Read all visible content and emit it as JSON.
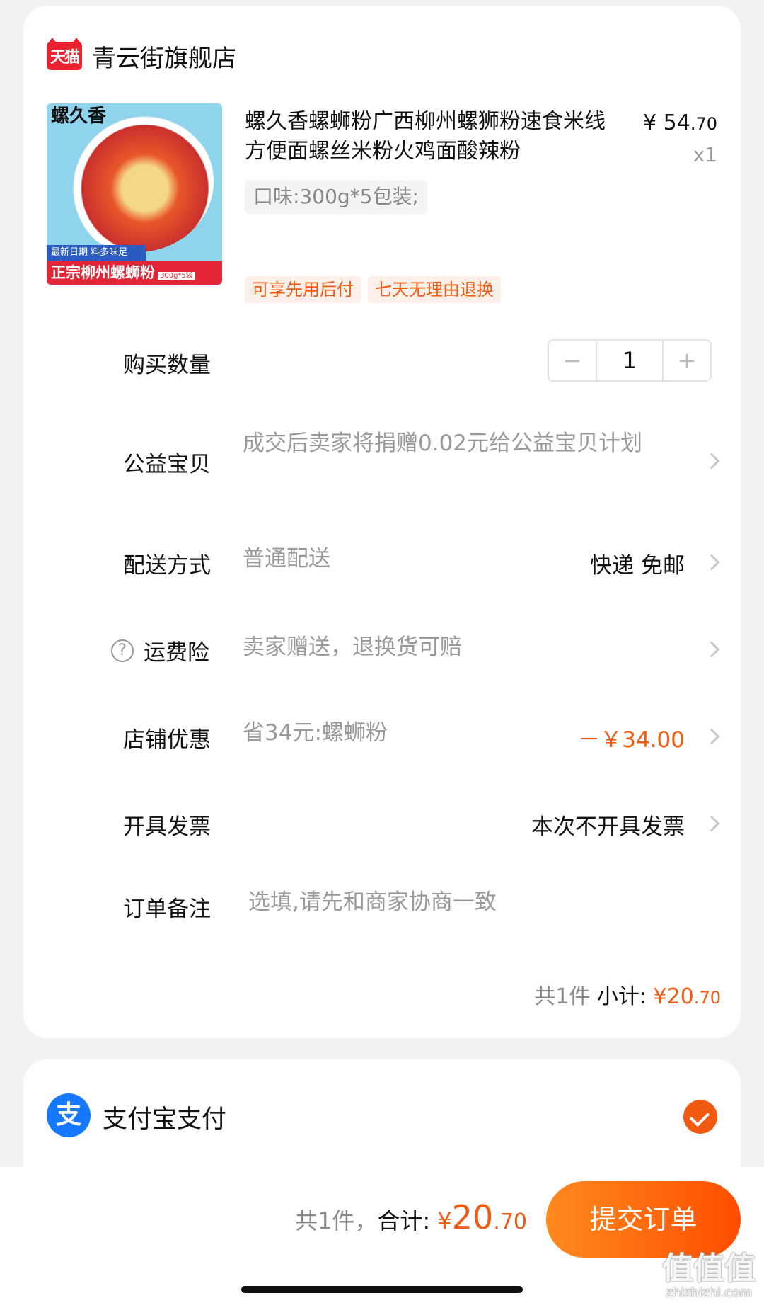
{
  "shop": {
    "logo_text": "天猫",
    "name": "青云街旗舰店"
  },
  "product": {
    "image": {
      "brand_text": "螺久香",
      "band1_text": "最新日期 料多味足",
      "band2_text": "正宗柳州螺蛳粉",
      "band2_small": "300g*5袋"
    },
    "title": "螺久香螺蛳粉广西柳州螺狮粉速食米线方便面螺丝米粉火鸡面酸辣粉",
    "price_yen": "¥",
    "price_int": "54",
    "price_dec": ".70",
    "quantity": "x1",
    "sku": "口味:300g*5包装;",
    "tags": [
      "可享先用后付",
      "七天无理由退换"
    ]
  },
  "rows": {
    "quantity": {
      "label": "购买数量",
      "minus": "−",
      "value": "1",
      "plus": "+"
    },
    "charity": {
      "label": "公益宝贝",
      "value": "成交后卖家将捐赠0.02元给公益宝贝计划"
    },
    "delivery": {
      "label": "配送方式",
      "value": "普通配送",
      "right": "快递 免邮"
    },
    "insurance": {
      "help_icon": "?",
      "label": "运费险",
      "value": "卖家赠送，退换货可赔"
    },
    "discount": {
      "label": "店铺优惠",
      "value": "省34元:螺蛳粉",
      "right": "－￥34.00"
    },
    "invoice": {
      "label": "开具发票",
      "right": "本次不开具发票"
    },
    "note": {
      "label": "订单备注",
      "placeholder": "选填,请先和商家协商一致"
    }
  },
  "subtotal": {
    "count": "共1件",
    "label": "小计:",
    "yen": "¥",
    "int": "20",
    "dec": ".70"
  },
  "payment": {
    "icon_text": "支",
    "label": "支付宝支付",
    "selected": true
  },
  "bottom": {
    "count": "共1件，",
    "label": "合计:",
    "yen": "¥",
    "int": "20",
    "dec": ".70",
    "submit": "提交订单"
  },
  "watermark": {
    "main": "值值值",
    "sub": "zhizhizhi.com"
  },
  "colors": {
    "accent": "#f25a11",
    "tmall_red": "#e8222e",
    "alipay_blue": "#1677ff"
  }
}
